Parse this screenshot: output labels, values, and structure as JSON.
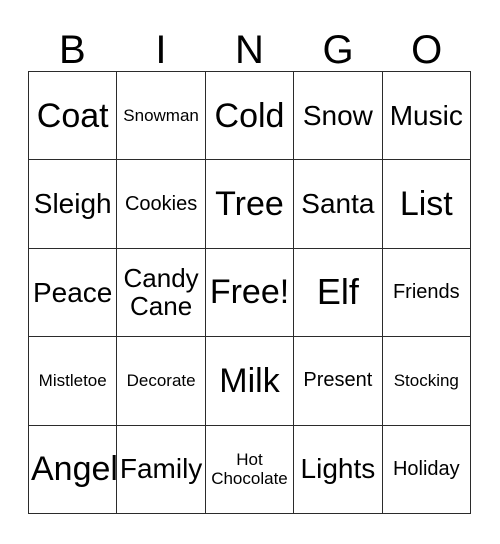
{
  "card": {
    "title": "BINGO",
    "background_color": "#ffffff",
    "border_color": "#2b2b2b",
    "text_color": "#000000"
  },
  "header": {
    "letters": [
      {
        "label": "B"
      },
      {
        "label": "I"
      },
      {
        "label": "N"
      },
      {
        "label": "G"
      },
      {
        "label": "O"
      }
    ]
  },
  "grid": {
    "columns": 5,
    "rows": 5,
    "free_space": "Free!",
    "cells": [
      [
        {
          "label": "Coat",
          "size": "fs-lg"
        },
        {
          "label": "Snowman",
          "size": "fs-xxs"
        },
        {
          "label": "Cold",
          "size": "fs-lg"
        },
        {
          "label": "Snow",
          "size": "fs-md"
        },
        {
          "label": "Music",
          "size": "fs-md"
        }
      ],
      [
        {
          "label": "Sleigh",
          "size": "fs-md"
        },
        {
          "label": "Cookies",
          "size": "fs-xs"
        },
        {
          "label": "Tree",
          "size": "fs-lg"
        },
        {
          "label": "Santa",
          "size": "fs-md"
        },
        {
          "label": "List",
          "size": "fs-lg"
        }
      ],
      [
        {
          "label": "Peace",
          "size": "fs-md"
        },
        {
          "label": "Candy\nCane",
          "size": "fs-two-lg"
        },
        {
          "label": "Free!",
          "size": "fs-lg"
        },
        {
          "label": "Elf",
          "size": "fs-xl"
        },
        {
          "label": "Friends",
          "size": "fs-xs"
        }
      ],
      [
        {
          "label": "Mistletoe",
          "size": "fs-xxs"
        },
        {
          "label": "Decorate",
          "size": "fs-xxs"
        },
        {
          "label": "Milk",
          "size": "fs-lg"
        },
        {
          "label": "Present",
          "size": "fs-xs"
        },
        {
          "label": "Stocking",
          "size": "fs-xxs"
        }
      ],
      [
        {
          "label": "Angel",
          "size": "fs-lg"
        },
        {
          "label": "Family",
          "size": "fs-md"
        },
        {
          "label": "Hot\nChocolate",
          "size": "fs-two-sm"
        },
        {
          "label": "Lights",
          "size": "fs-md"
        },
        {
          "label": "Holiday",
          "size": "fs-xs"
        }
      ]
    ]
  }
}
